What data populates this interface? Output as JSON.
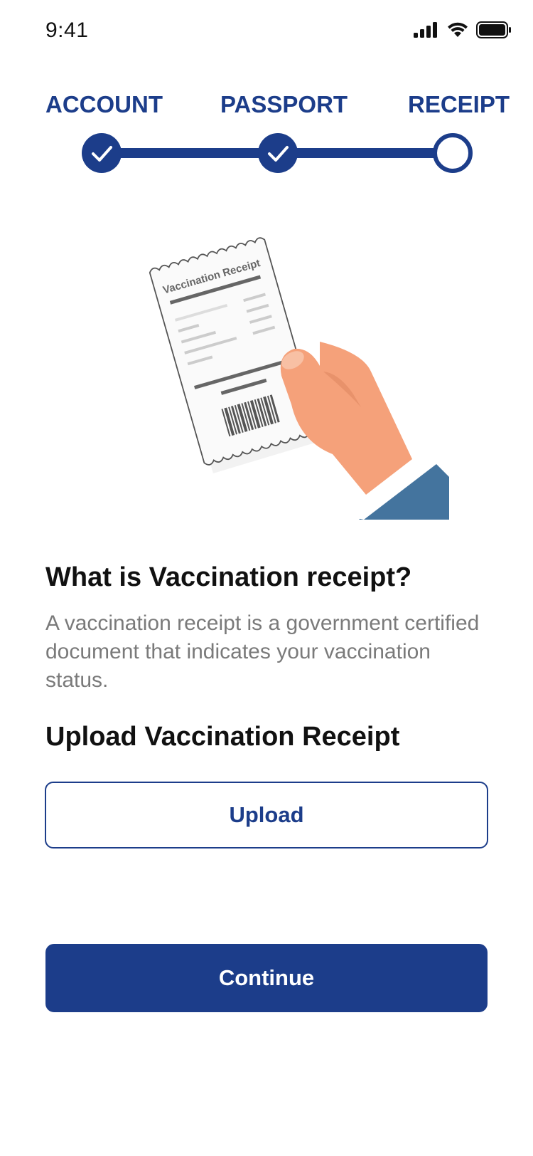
{
  "status_bar": {
    "time": "9:41",
    "icons": [
      "cellular-signal-icon",
      "wifi-icon",
      "battery-icon"
    ]
  },
  "stepper": {
    "steps": [
      {
        "label": "ACCOUNT",
        "state": "completed"
      },
      {
        "label": "PASSPORT",
        "state": "completed"
      },
      {
        "label": "RECEIPT",
        "state": "current"
      }
    ]
  },
  "illustration": {
    "receipt_title": "Vaccination Receipt",
    "icon": "hand-holding-receipt-illustration"
  },
  "content": {
    "question": "What is Vaccination receipt?",
    "description": "A vaccination receipt is a government certified document that indicates your vaccination status.",
    "upload_title": "Upload Vaccination Receipt"
  },
  "buttons": {
    "upload_label": "Upload",
    "continue_label": "Continue"
  },
  "colors": {
    "primary": "#1c3d8a",
    "text_dark": "#111111",
    "text_muted": "#7a7a7a",
    "skin": "#f5a17a",
    "sleeve": "#44749e"
  }
}
